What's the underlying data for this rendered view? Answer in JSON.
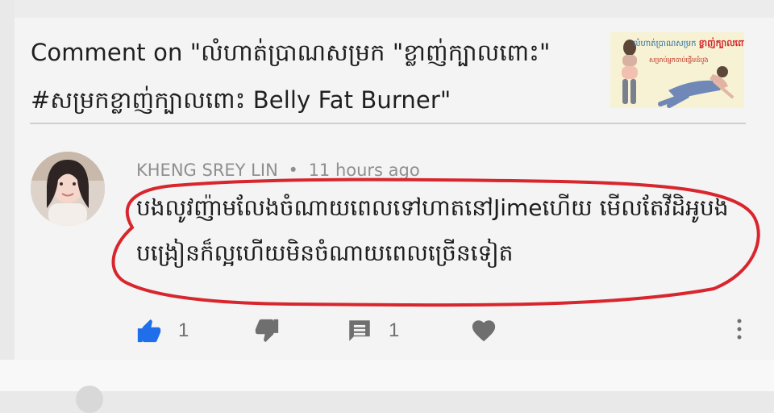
{
  "header": {
    "title": "Comment on \"លំហាត់ប្រាណសម្រក \"ខ្លាញ់ក្បាលពោះ\" #សម្រកខ្លាញ់ក្បាលពោះ Belly Fat Burner\"",
    "thumbnail": {
      "top_line_part1": "លំហាត់ប្រាណសម្រក",
      "top_line_part2": "ខ្លាញ់ក្បាលពោះ",
      "sub_line": "សម្រាប់អ្នកចាប់ផ្ដើមដំបូង"
    }
  },
  "comment": {
    "author": "KHENG SREY LIN",
    "separator": "•",
    "time": "11 hours ago",
    "text": "បងលូវញ៉ាមលែងចំណាយពេលទៅហាតនៅJimeហើយ មើលតែវីដិអូបងបង្រៀនក៏ល្អហើយមិនចំណាយពេលច្រើនទៀត"
  },
  "actions": {
    "like_count": "1",
    "reply_count": "1"
  },
  "colors": {
    "card_background": "#f4f4f4",
    "like_blue": "#1f6feb",
    "icon_gray": "#6f6f6f",
    "highlight_red": "#d7262d"
  },
  "icons": {
    "like": "thumbs-up-icon",
    "dislike": "thumbs-down-icon",
    "reply": "comment-icon",
    "heart": "heart-icon",
    "more": "more-vertical-icon"
  }
}
